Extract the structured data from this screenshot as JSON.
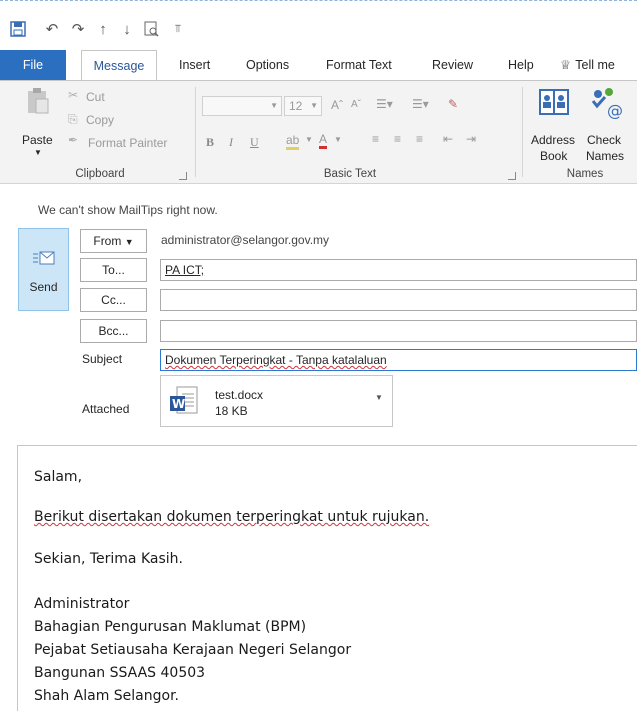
{
  "qat": {
    "icons": [
      "save-icon",
      "undo-icon",
      "redo-icon",
      "up-icon",
      "down-icon",
      "print-preview-icon",
      "customize-icon"
    ]
  },
  "tabs": [
    {
      "label": "File"
    },
    {
      "label": "Message"
    },
    {
      "label": "Insert"
    },
    {
      "label": "Options"
    },
    {
      "label": "Format Text"
    },
    {
      "label": "Review"
    },
    {
      "label": "Help"
    },
    {
      "label": "Tell me"
    }
  ],
  "ribbon": {
    "clipboard": {
      "paste": "Paste",
      "cut": "Cut",
      "copy": "Copy",
      "format_painter": "Format Painter",
      "label": "Clipboard"
    },
    "basic_text": {
      "font_size": "12",
      "bold": "B",
      "italic": "I",
      "underline": "U",
      "label": "Basic Text"
    },
    "names": {
      "address_book_1": "Address",
      "address_book_2": "Book",
      "check_names_1": "Check",
      "check_names_2": "Names",
      "label": "Names"
    }
  },
  "mailtips": "We can't show MailTips right now.",
  "send_label": "Send",
  "header": {
    "from_label": "From",
    "from_value": "administrator@selangor.gov.my",
    "to_label": "To...",
    "to_value": "PA ICT;",
    "cc_label": "Cc...",
    "cc_value": "",
    "bcc_label": "Bcc...",
    "bcc_value": "",
    "subject_label": "Subject",
    "subject_value": "Dokumen Terperingkat - Tanpa katalaluan",
    "attached_label": "Attached"
  },
  "attachment": {
    "name": "test.docx",
    "size": "18 KB"
  },
  "body": {
    "lines": [
      "Salam,",
      "Berikut disertakan dokumen terperingkat untuk rujukan.",
      "Sekian, Terima Kasih.",
      "Administrator",
      "Bahagian Pengurusan Maklumat (BPM)",
      "Pejabat Setiausaha Kerajaan Negeri Selangor",
      "Bangunan SSAAS 40503",
      "Shah Alam Selangor."
    ]
  },
  "colors": {
    "accent": "#2b70c0",
    "send_bg": "#cde6f7",
    "spell_error": "#d13438"
  }
}
